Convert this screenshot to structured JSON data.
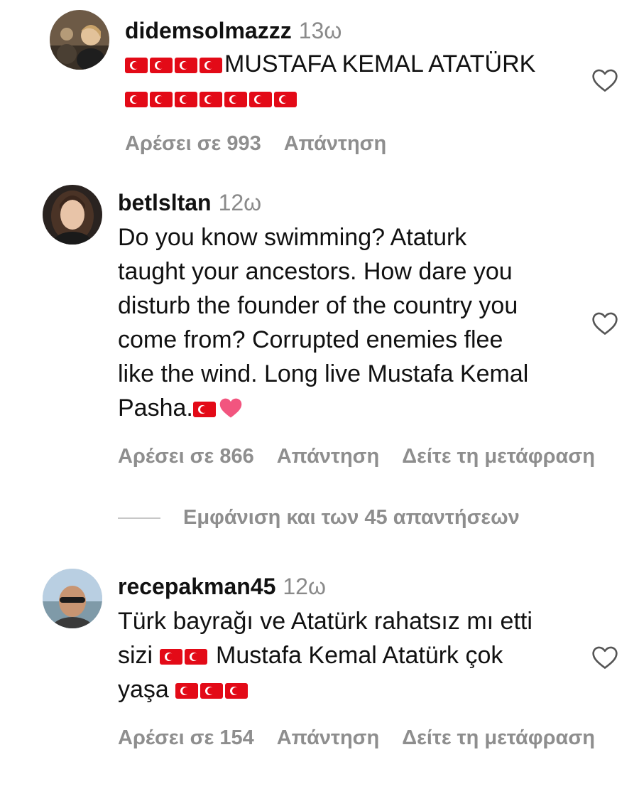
{
  "comments": [
    {
      "username": "didemsolmazzz",
      "time": "13ω",
      "lines": [
        "MUSTAFA KEMAL ATATÜRK"
      ],
      "likes_label": "Αρέσει σε 993",
      "reply_label": "Απάντηση"
    },
    {
      "username": "betlsltan",
      "time": "12ω",
      "lines": [
        "Do you know swimming? Ataturk",
        "taught your ancestors. How dare you",
        "disturb the founder of the country you",
        "come from? Corrupted enemies flee",
        "like the wind. Long live Mustafa Kemal",
        "Pasha."
      ],
      "likes_label": "Αρέσει σε 866",
      "reply_label": "Απάντηση",
      "translate_label": "Δείτε τη μετάφραση"
    },
    {
      "username": "recepakman45",
      "time": "12ω",
      "lines": [
        "Türk bayrağı ve Atatürk rahatsız mı etti",
        "sizi",
        "Mustafa Kemal Atatürk çok",
        "yaşa"
      ],
      "likes_label": "Αρέσει σε 154",
      "reply_label": "Απάντηση",
      "translate_label": "Δείτε τη μετάφραση"
    }
  ],
  "view_replies_label": "Εμφάνιση και των 45 απαντήσεων",
  "emoji": {
    "flag": "turkey-flag",
    "heart": "pink-heart"
  },
  "colors": {
    "text": "#111111",
    "muted": "#8e8e8e",
    "flag": "#e30a17"
  }
}
